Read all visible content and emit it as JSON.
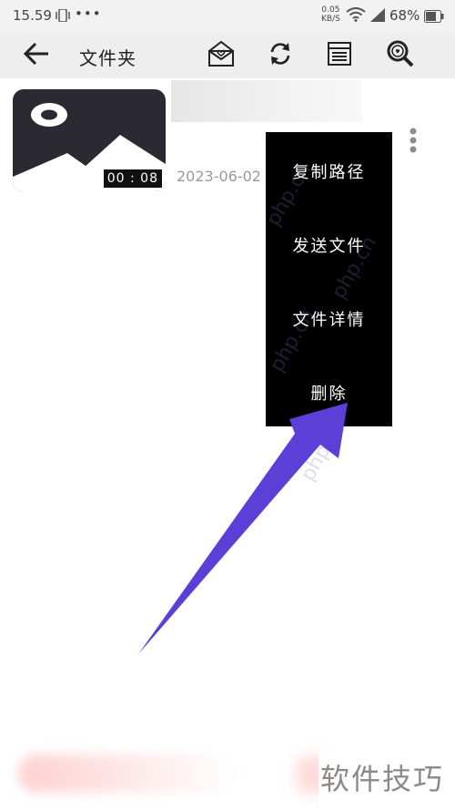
{
  "status_bar": {
    "time": "15.59",
    "dots": "•••",
    "speed_value": "0.05",
    "speed_unit": "KB/S",
    "battery": "68%"
  },
  "app_bar": {
    "title": "文件夹",
    "icons": [
      "back-arrow-icon",
      "envelope-heart-icon",
      "refresh-icon",
      "list-window-icon",
      "search-heart-icon"
    ]
  },
  "file": {
    "duration": "00 : 08",
    "date": "2023-06-02"
  },
  "context_menu": {
    "items": [
      "复制路径",
      "发送文件",
      "文件详情",
      "删除"
    ]
  },
  "watermark": {
    "text": "php.cn",
    "corner": "软件技巧"
  },
  "colors": {
    "arrow": "#5b3fd6",
    "menu_bg": "#000000",
    "app_bar_bg": "#eeeeee"
  }
}
